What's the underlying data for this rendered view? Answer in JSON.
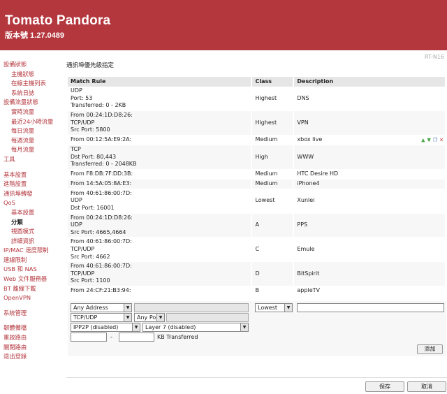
{
  "header": {
    "title": "Tomato Pandora",
    "version": "版本號 1.27.0489"
  },
  "model": "RT-N16",
  "section_title": "通訊埠優先級指定",
  "sidebar": [
    {
      "label": "設備狀態",
      "level": 1
    },
    {
      "label": "主機狀態",
      "level": 2
    },
    {
      "label": "在線主機列表",
      "level": 2
    },
    {
      "label": "系統日誌",
      "level": 2
    },
    {
      "label": "設備流量狀態",
      "level": 1
    },
    {
      "label": "實時流量",
      "level": 2
    },
    {
      "label": "最近24小時流量",
      "level": 2
    },
    {
      "label": "每日流量",
      "level": 2
    },
    {
      "label": "每週流量",
      "level": 2
    },
    {
      "label": "每月流量",
      "level": 2
    },
    {
      "label": "工具",
      "level": 1
    },
    {
      "label": "",
      "level": 0
    },
    {
      "label": "基本設置",
      "level": 1
    },
    {
      "label": "進階設置",
      "level": 1
    },
    {
      "label": "通訊埠轉發",
      "level": 1
    },
    {
      "label": "QoS",
      "level": 1
    },
    {
      "label": "基本設置",
      "level": 2
    },
    {
      "label": "分類",
      "level": 2,
      "active": true
    },
    {
      "label": "視圖模式",
      "level": 2
    },
    {
      "label": "詳細資訊",
      "level": 2
    },
    {
      "label": "IP/MAC 速度限制",
      "level": 1
    },
    {
      "label": "連線限制",
      "level": 1
    },
    {
      "label": "USB 和 NAS",
      "level": 1
    },
    {
      "label": "Web 文件服務器",
      "level": 1
    },
    {
      "label": "BT 離線下載",
      "level": 1
    },
    {
      "label": "OpenVPN",
      "level": 1
    },
    {
      "label": "",
      "level": 0
    },
    {
      "label": "系統管理",
      "level": 1
    },
    {
      "label": "",
      "level": 0
    },
    {
      "label": "韌體備檔",
      "level": 1
    },
    {
      "label": "重啟路由",
      "level": 1
    },
    {
      "label": "關閉路由",
      "level": 1
    },
    {
      "label": "退出登錄",
      "level": 1
    }
  ],
  "table": {
    "headers": [
      "Match Rule",
      "Class",
      "Description"
    ],
    "rows": [
      {
        "rule": [
          "UDP",
          "Port: 53",
          "Transferred: 0 - 2KB"
        ],
        "class": "Highest",
        "desc": "DNS"
      },
      {
        "rule": [
          "From 00:24:1D:D8:26:",
          "TCP/UDP",
          "Src Port: 5800"
        ],
        "class": "Highest",
        "desc": "VPN"
      },
      {
        "rule": [
          "From 00:12:5A:E9:2A:"
        ],
        "class": "Medium",
        "desc": "xbox live",
        "selected": true
      },
      {
        "rule": [
          "TCP",
          "Dst Port: 80,443",
          "Transferred: 0 - 2048KB"
        ],
        "class": "High",
        "desc": "WWW"
      },
      {
        "rule": [
          "From F8:DB:7F:DD:3B:"
        ],
        "class": "Medium",
        "desc": "HTC Desire HD"
      },
      {
        "rule": [
          "From 14:5A:05:8A:E3:"
        ],
        "class": "Medium",
        "desc": "iPhone4"
      },
      {
        "rule": [
          "From 40:61:86:00:7D:",
          "UDP",
          "Dst Port: 16001"
        ],
        "class": "Lowest",
        "desc": "Xunlei"
      },
      {
        "rule": [
          "From 00:24:1D:D8:26:",
          "UDP",
          "Src Port: 4665,4664"
        ],
        "class": "A",
        "desc": "PPS"
      },
      {
        "rule": [
          "From 40:61:86:00:7D:",
          "TCP/UDP",
          "Src Port: 4662"
        ],
        "class": "C",
        "desc": "Emule"
      },
      {
        "rule": [
          "From 40:61:86:00:7D:",
          "TCP/UDP",
          "Src Port: 1100"
        ],
        "class": "D",
        "desc": "BitSpirit"
      },
      {
        "rule": [
          "From 24:CF:21:B3:94:"
        ],
        "class": "B",
        "desc": "appleTV"
      }
    ],
    "icons": [
      "move-up-icon",
      "move-down-icon",
      "copy-icon",
      "delete-icon"
    ]
  },
  "editor": {
    "address_select": "Any Address",
    "protocol_select": "TCP/UDP",
    "port_select": "Any Port",
    "ipp2p_select": "IPP2P (disabled)",
    "layer7_select": "Layer 7 (disabled)",
    "class_select": "Lowest",
    "range_separator": "-",
    "kb_label": "KB Transferred",
    "add_button": "添加"
  },
  "footer": {
    "save_button": "保存",
    "cancel_button": "取消"
  }
}
